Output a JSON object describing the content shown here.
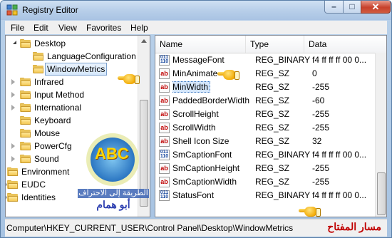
{
  "window": {
    "title": "Registry Editor",
    "controls": {
      "minimize": "–",
      "maximize": "□",
      "close": "✕"
    }
  },
  "menu": [
    {
      "label": "File"
    },
    {
      "label": "Edit"
    },
    {
      "label": "View"
    },
    {
      "label": "Favorites"
    },
    {
      "label": "Help"
    }
  ],
  "tree": [
    {
      "label": "Desktop",
      "expanded": true
    },
    {
      "label": "LanguageConfiguration"
    },
    {
      "label": "WindowMetrics",
      "selected": true
    },
    {
      "label": "Infrared"
    },
    {
      "label": "Input Method"
    },
    {
      "label": "International"
    },
    {
      "label": "Keyboard"
    },
    {
      "label": "Mouse"
    },
    {
      "label": "PowerCfg"
    },
    {
      "label": "Sound"
    },
    {
      "label": "Environment"
    },
    {
      "label": "EUDC"
    },
    {
      "label": "Identities"
    }
  ],
  "list": {
    "columns": [
      "Name",
      "Type",
      "Data"
    ],
    "rows": [
      {
        "name": "MessageFont",
        "type": "REG_BINARY",
        "data": "f4 ff ff ff 00 0...",
        "icon": "binary-value-icon"
      },
      {
        "name": "MinAnimate",
        "type": "REG_SZ",
        "data": "0",
        "icon": "string-value-icon"
      },
      {
        "name": "MinWidth",
        "type": "REG_SZ",
        "data": "-255",
        "icon": "string-value-icon",
        "selected": true
      },
      {
        "name": "PaddedBorderWidth",
        "type": "REG_SZ",
        "data": "-60",
        "icon": "string-value-icon"
      },
      {
        "name": "ScrollHeight",
        "type": "REG_SZ",
        "data": "-255",
        "icon": "string-value-icon"
      },
      {
        "name": "ScrollWidth",
        "type": "REG_SZ",
        "data": "-255",
        "icon": "string-value-icon"
      },
      {
        "name": "Shell Icon Size",
        "type": "REG_SZ",
        "data": "32",
        "icon": "string-value-icon"
      },
      {
        "name": "SmCaptionFont",
        "type": "REG_BINARY",
        "data": "f4 ff ff ff 00 0...",
        "icon": "binary-value-icon"
      },
      {
        "name": "SmCaptionHeight",
        "type": "REG_SZ",
        "data": "-255",
        "icon": "string-value-icon"
      },
      {
        "name": "SmCaptionWidth",
        "type": "REG_SZ",
        "data": "-255",
        "icon": "string-value-icon"
      },
      {
        "name": "StatusFont",
        "type": "REG_BINARY",
        "data": "f4 ff ff ff 00 0...",
        "icon": "binary-value-icon"
      }
    ]
  },
  "icon_glyphs": {
    "string": "ab",
    "binary": "011\n110"
  },
  "status": {
    "path": "Computer\\HKEY_CURRENT_USER\\Control Panel\\Desktop\\WindowMetrics",
    "annotation": "مسار المفتاح"
  },
  "watermark": {
    "letters": "ABC",
    "line1": "الطريقة إلى الاحتراف",
    "line2": "أبو همام"
  },
  "colors": {
    "selection": "#d4e6fb",
    "titlebar": "#b8cfe9",
    "annotation": "#c00000"
  }
}
